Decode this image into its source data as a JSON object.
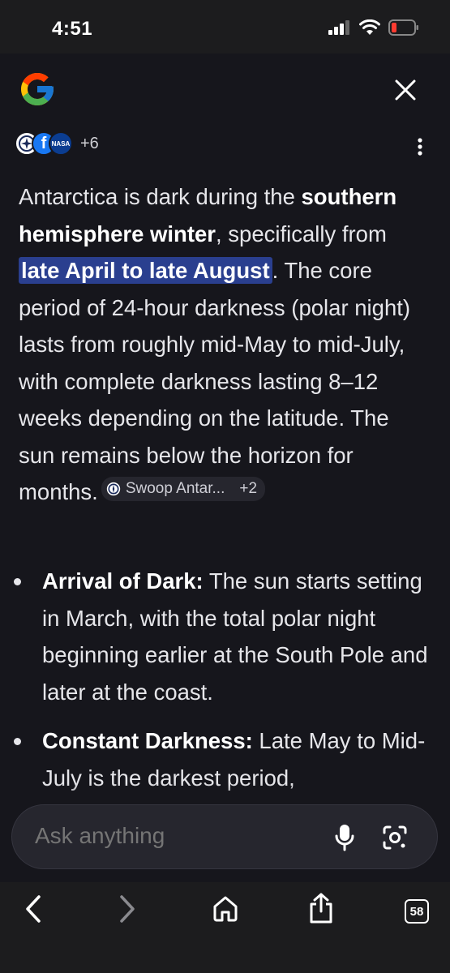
{
  "status_bar": {
    "time": "4:51"
  },
  "header": {
    "logo": "google-g-logo",
    "close_icon": "close-icon"
  },
  "sources": {
    "avatars": [
      "S",
      "f",
      "NASA"
    ],
    "more_count": "+6"
  },
  "answer": {
    "intro": "Antarctica is dark during the ",
    "bold1": "southern hemisphere winter",
    "text2": ", specifically from ",
    "highlight": "late April to late August",
    "text3": ". The core period of 24-hour darkness (polar night) lasts from roughly mid-May to mid-July, with complete darkness lasting 8–12 weeks depending on the latitude. The sun remains below the horizon for months.",
    "chip_label": "Swoop Antar...",
    "chip_count": "+2"
  },
  "bullets": [
    {
      "title": "Arrival of Dark:",
      "text": " The sun starts setting in March, with the total polar night beginning earlier at the South Pole and later at the coast."
    },
    {
      "title": "Constant Darkness:",
      "text": " Late May to Mid-July is the darkest period,"
    }
  ],
  "ask_bar": {
    "placeholder": "Ask anything"
  },
  "bottom_nav": {
    "tab_count": "58"
  },
  "colors": {
    "panel_bg": "#16161c",
    "highlight_bg": "#2a3f8f",
    "chip_bg": "#26262e"
  }
}
